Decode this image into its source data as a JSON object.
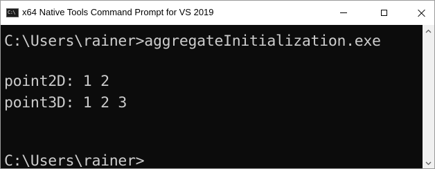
{
  "window": {
    "title": "x64 Native Tools Command Prompt for VS 2019",
    "icon": "command-prompt-icon",
    "icon_glyph": "C:\\"
  },
  "controls": {
    "minimize_icon": "minimize-icon",
    "maximize_icon": "maximize-icon",
    "close_icon": "close-icon"
  },
  "console": {
    "lines": [
      "C:\\Users\\rainer>aggregateInitialization.exe",
      "",
      "point2D: 1 2",
      "point3D: 1 2 3",
      "",
      "",
      "C:\\Users\\rainer>"
    ],
    "text_color": "#cccccc",
    "background_color": "#0c0c0c"
  }
}
